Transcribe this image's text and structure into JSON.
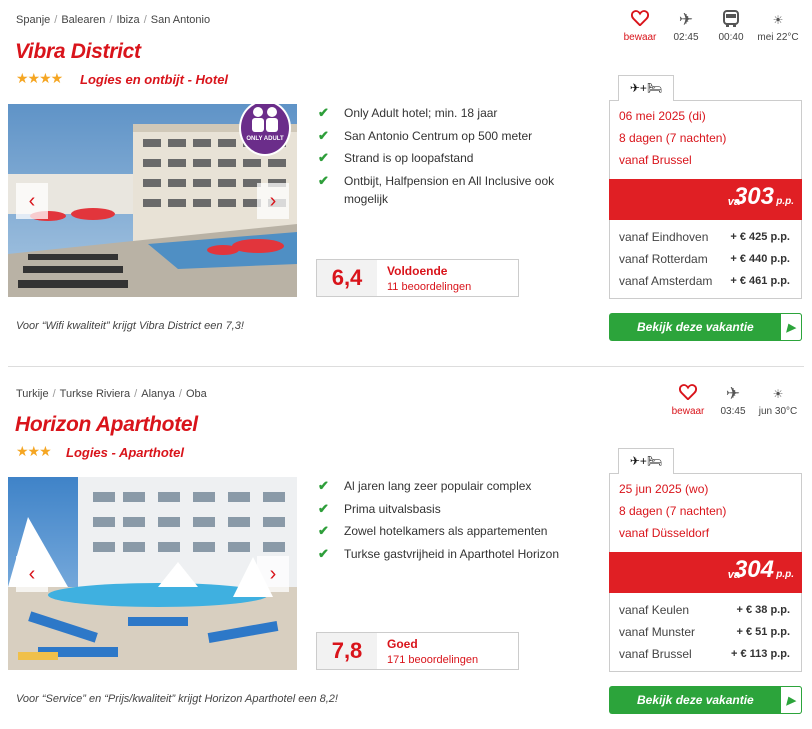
{
  "hotels": [
    {
      "breadcrumb": [
        "Spanje",
        "Balearen",
        "Ibiza",
        "San Antonio"
      ],
      "name": "Vibra District",
      "stars": "★★★★",
      "board": "Logies en ontbijt - Hotel",
      "badge": "ONLY ADULT",
      "features": [
        "Only Adult hotel; min. 18 jaar",
        "San Antonio Centrum op 500 meter",
        "Strand is op loopafstand",
        "Ontbijt, Halfpension en All Inclusive ook mogelijk"
      ],
      "rating": {
        "score": "6,4",
        "label": "Voldoende",
        "reviews": "11 beoordelingen"
      },
      "quote": "Voor “Wifi kwaliteit” krijgt Vibra District een 7,3!",
      "icons": {
        "save": "bewaar",
        "flight": "02:45",
        "transfer": "00:40",
        "weather": "mei 22°C"
      },
      "price_tab": "✈+🛏",
      "date": "06 mei 2025 (di)",
      "duration": "8 dagen (7 nachten)",
      "departure": "vanaf Brussel",
      "price_prefix": "va",
      "price": "303",
      "price_suffix": "p.p.",
      "alternatives": [
        {
          "from": "vanaf Eindhoven",
          "supplement": "+ € 425 p.p."
        },
        {
          "from": "vanaf Rotterdam",
          "supplement": "+ € 440 p.p."
        },
        {
          "from": "vanaf Amsterdam",
          "supplement": "+ € 461 p.p."
        }
      ],
      "cta": "Bekijk deze vakantie"
    },
    {
      "breadcrumb": [
        "Turkije",
        "Turkse Riviera",
        "Alanya",
        "Oba"
      ],
      "name": "Horizon Aparthotel",
      "stars": "★★★",
      "board": "Logies - Aparthotel",
      "features": [
        "Al jaren lang zeer populair complex",
        "Prima uitvalsbasis",
        "Zowel hotelkamers als appartementen",
        "Turkse gastvrijheid in Aparthotel Horizon"
      ],
      "rating": {
        "score": "7,8",
        "label": "Goed",
        "reviews": "171 beoordelingen"
      },
      "quote": "Voor “Service” en “Prijs/kwaliteit” krijgt Horizon Aparthotel een 8,2!",
      "icons": {
        "save": "bewaar",
        "flight": "03:45",
        "weather": "jun 30°C"
      },
      "price_tab": "✈+🛏",
      "date": "25 jun 2025 (wo)",
      "duration": "8 dagen (7 nachten)",
      "departure": "vanaf Düsseldorf",
      "price_prefix": "va",
      "price": "304",
      "price_suffix": "p.p.",
      "alternatives": [
        {
          "from": "vanaf Keulen",
          "supplement": "+ € 38 p.p."
        },
        {
          "from": "vanaf Munster",
          "supplement": "+ € 51 p.p."
        },
        {
          "from": "vanaf Brussel",
          "supplement": "+ € 113 p.p."
        }
      ],
      "cta": "Bekijk deze vakantie"
    }
  ],
  "icon_names": {
    "save": "heart-icon",
    "flight": "airplane-icon",
    "transfer": "bus-icon",
    "weather": "sun-icon"
  },
  "colors": {
    "brand_red": "#d9141b",
    "price_red": "#e01f24",
    "cta_green": "#2ca43b",
    "check_green": "#2e9e3a",
    "star": "#f5a623",
    "badge_purple": "#6b2d8a"
  }
}
